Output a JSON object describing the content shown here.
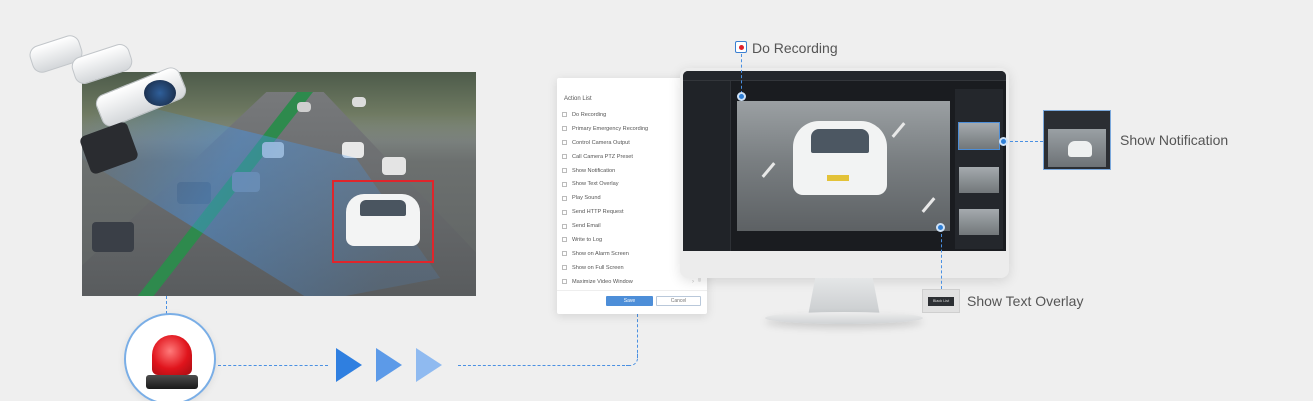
{
  "action_list": {
    "title": "Action List",
    "items": [
      {
        "label": "Do Recording"
      },
      {
        "label": "Primary Emergency Recording"
      },
      {
        "label": "Control Camera Output"
      },
      {
        "label": "Call Camera PTZ Preset"
      },
      {
        "label": "Show Notification"
      },
      {
        "label": "Show Text Overlay"
      },
      {
        "label": "Play Sound"
      },
      {
        "label": "Send HTTP Request"
      },
      {
        "label": "Send Email"
      },
      {
        "label": "Write to Log"
      },
      {
        "label": "Show on Alarm Screen"
      },
      {
        "label": "Show on Full Screen"
      },
      {
        "label": "Maximize Video Window"
      }
    ],
    "save_label": "Save",
    "cancel_label": "Cancel"
  },
  "callouts": {
    "do_recording": "Do Recording",
    "show_notification": "Show Notification",
    "show_text_overlay": "Show Text Overlay"
  },
  "overlay_chip": {
    "text": "Black List"
  },
  "colors": {
    "accent_blue": "#4a90e2",
    "detect_red": "#e0252b",
    "alarm_red": "#e0141c",
    "save_button": "#4d8ed8"
  },
  "icons": {
    "alarm": "alarm-light-icon",
    "flow_arrows": "triangle-right-icon",
    "record": "record-dot-icon"
  }
}
